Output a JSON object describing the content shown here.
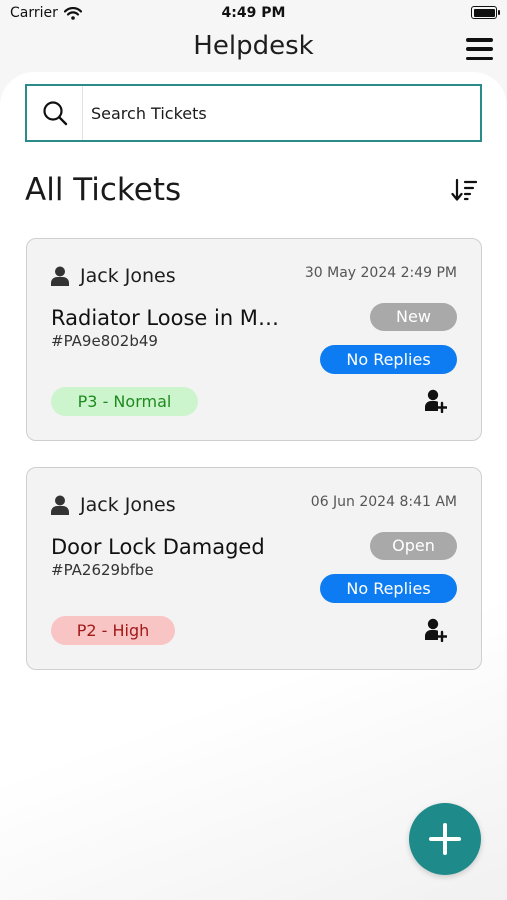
{
  "status_bar": {
    "carrier": "Carrier",
    "time": "4:49 PM"
  },
  "header": {
    "title": "Helpdesk",
    "menu_icon": "hamburger-menu-icon"
  },
  "search": {
    "placeholder": "Search Tickets",
    "value": "",
    "icon": "search-icon"
  },
  "section": {
    "title": "All Tickets",
    "sort_icon": "sort-descending-icon"
  },
  "tickets": [
    {
      "requester": "Jack Jones",
      "date": "30 May 2024 2:49 PM",
      "title": "Radiator Loose in Main Hall",
      "id": "#PA9e802b49",
      "status": "New",
      "replies": "No Replies",
      "priority": "P3 - Normal",
      "priority_colors": {
        "bg": "#cdf5cd",
        "fg": "#1f8a1f"
      }
    },
    {
      "requester": "Jack Jones",
      "date": "06 Jun 2024 8:41 AM",
      "title": "Door Lock Damaged",
      "id": "#PA2629bfbe",
      "status": "Open",
      "replies": "No Replies",
      "priority": "P2 - High",
      "priority_colors": {
        "bg": "#f8c4c4",
        "fg": "#a11a1a"
      }
    }
  ],
  "colors": {
    "accent": "#1f8a8a",
    "search_border": "#2b8a8a",
    "replies_blue": "#0d7cf2",
    "status_gray": "#a9a9a9"
  },
  "fab": {
    "icon": "plus-icon"
  }
}
